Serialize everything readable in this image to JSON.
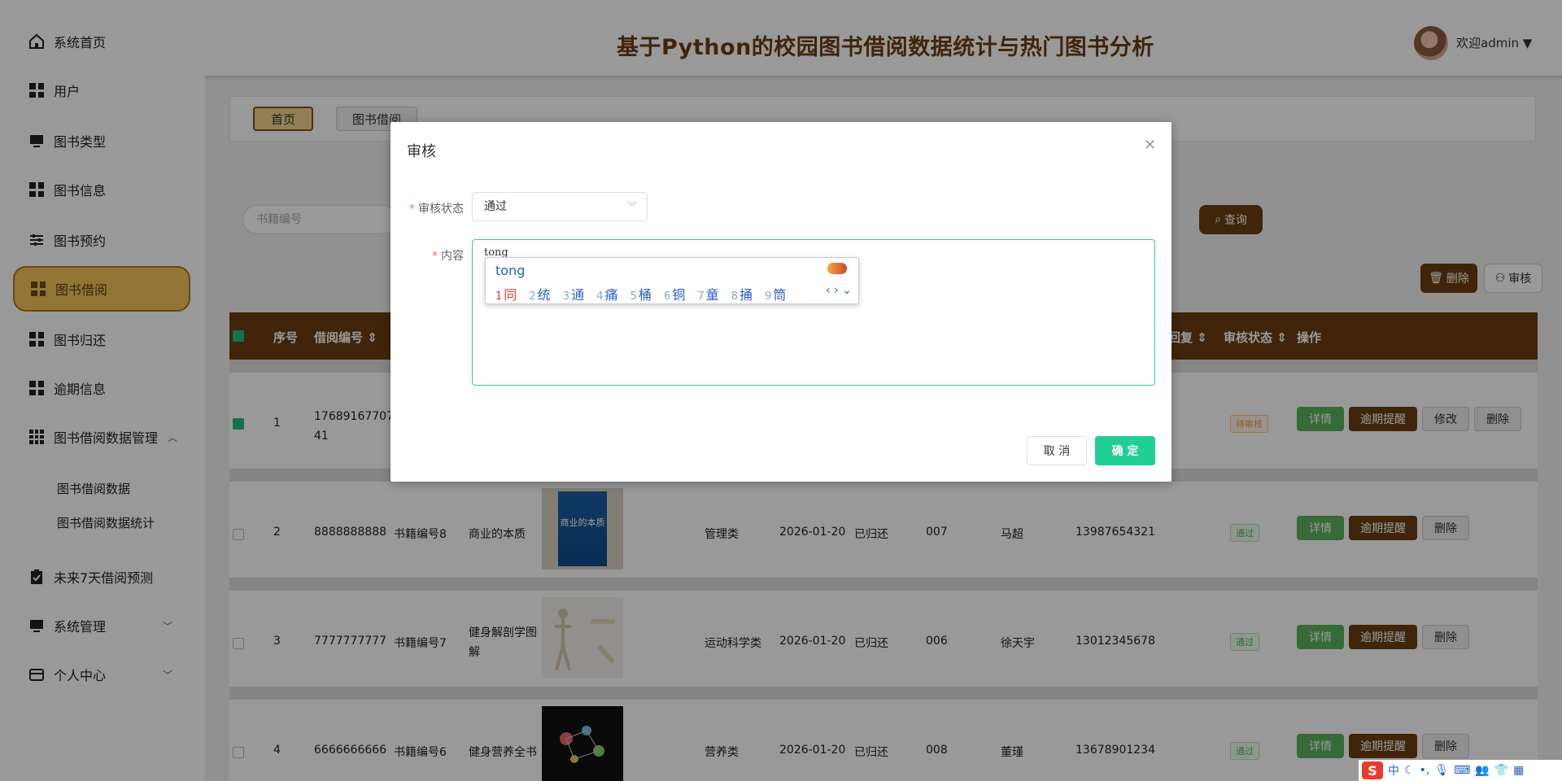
{
  "header": {
    "title": "基于Python的校园图书借阅数据统计与热门图书分析",
    "user": "欢迎admin ▼"
  },
  "sidebar": {
    "items": [
      {
        "label": "系统首页",
        "icon": "home-icon"
      },
      {
        "label": "用户",
        "icon": "grid-icon"
      },
      {
        "label": "图书类型",
        "icon": "monitor-icon"
      },
      {
        "label": "图书信息",
        "icon": "grid-icon"
      },
      {
        "label": "图书预约",
        "icon": "sliders-icon"
      },
      {
        "label": "图书借阅",
        "icon": "grid-icon",
        "active": true
      },
      {
        "label": "图书归还",
        "icon": "grid-icon"
      },
      {
        "label": "逾期信息",
        "icon": "grid-icon"
      },
      {
        "label": "图书借阅数据管理",
        "icon": "grid9-icon",
        "expanded": true
      },
      {
        "label": "未来7天借阅预测",
        "icon": "clipboard-check-icon"
      },
      {
        "label": "系统管理",
        "icon": "monitor-icon"
      },
      {
        "label": "个人中心",
        "icon": "wallet-icon"
      }
    ],
    "sub_items": [
      "图书借阅数据",
      "图书借阅数据统计"
    ]
  },
  "tabs": {
    "home": "首页",
    "borrow": "图书借阅"
  },
  "search": {
    "placeholder": "书籍编号",
    "query_label": "查询"
  },
  "toolbar": {
    "delete_label": "删除",
    "audit_label": "审核"
  },
  "table": {
    "headers": {
      "index": "序号",
      "borrow_no": "借阅编号 ⇕",
      "reply": "回复 ⇕",
      "status": "审核状态 ⇕",
      "ops": "操作"
    },
    "rows": [
      {
        "index": "1",
        "borrow_no": "17689167707\n41",
        "status": "待审核",
        "checked": true,
        "ops": [
          "详情",
          "逾期提醒",
          "修改",
          "删除"
        ]
      },
      {
        "index": "2",
        "borrow_no": "8888888888",
        "book_no": "书籍编号8",
        "book_name": "商业的本质",
        "category": "管理类",
        "date": "2026-01-20",
        "state": "已归还",
        "card": "007",
        "name": "马超",
        "phone": "13987654321",
        "status": "通过",
        "ops": [
          "详情",
          "逾期提醒",
          "删除"
        ]
      },
      {
        "index": "3",
        "borrow_no": "7777777777",
        "book_no": "书籍编号7",
        "book_name": "健身解剖学图解",
        "category": "运动科学类",
        "date": "2026-01-20",
        "state": "已归还",
        "card": "006",
        "name": "徐天宇",
        "phone": "13012345678",
        "status": "通过",
        "ops": [
          "详情",
          "逾期提醒",
          "删除"
        ]
      },
      {
        "index": "4",
        "borrow_no": "6666666666",
        "book_no": "书籍编号6",
        "book_name": "健身营养全书",
        "category": "营养类",
        "date": "2026-01-20",
        "state": "已归还",
        "card": "008",
        "name": "董瑾",
        "phone": "13678901234",
        "status": "通过",
        "ops": [
          "详情",
          "逾期提醒",
          "删除"
        ]
      }
    ],
    "cover_texts": {
      "row2": "商业的本质"
    }
  },
  "modal": {
    "title": "审核",
    "status_label": "审核状态",
    "status_value": "通过",
    "content_label": "内容",
    "content_value": "tong",
    "cancel": "取 消",
    "ok": "确 定"
  },
  "ime": {
    "pinyin": "tong",
    "candidates": [
      {
        "n": "1",
        "c": "同"
      },
      {
        "n": "2",
        "c": "统"
      },
      {
        "n": "3",
        "c": "通"
      },
      {
        "n": "4",
        "c": "痛"
      },
      {
        "n": "5",
        "c": "桶"
      },
      {
        "n": "6",
        "c": "铜"
      },
      {
        "n": "7",
        "c": "童"
      },
      {
        "n": "8",
        "c": "捅"
      },
      {
        "n": "9",
        "c": "筒"
      }
    ],
    "nav": "‹ › ⌄"
  },
  "tray": {
    "lang": "中"
  },
  "colors": {
    "brand": "#6b3f12",
    "active_nav": "#f5c35a",
    "confirm": "#1fcf94",
    "detail": "#5bb35e"
  }
}
